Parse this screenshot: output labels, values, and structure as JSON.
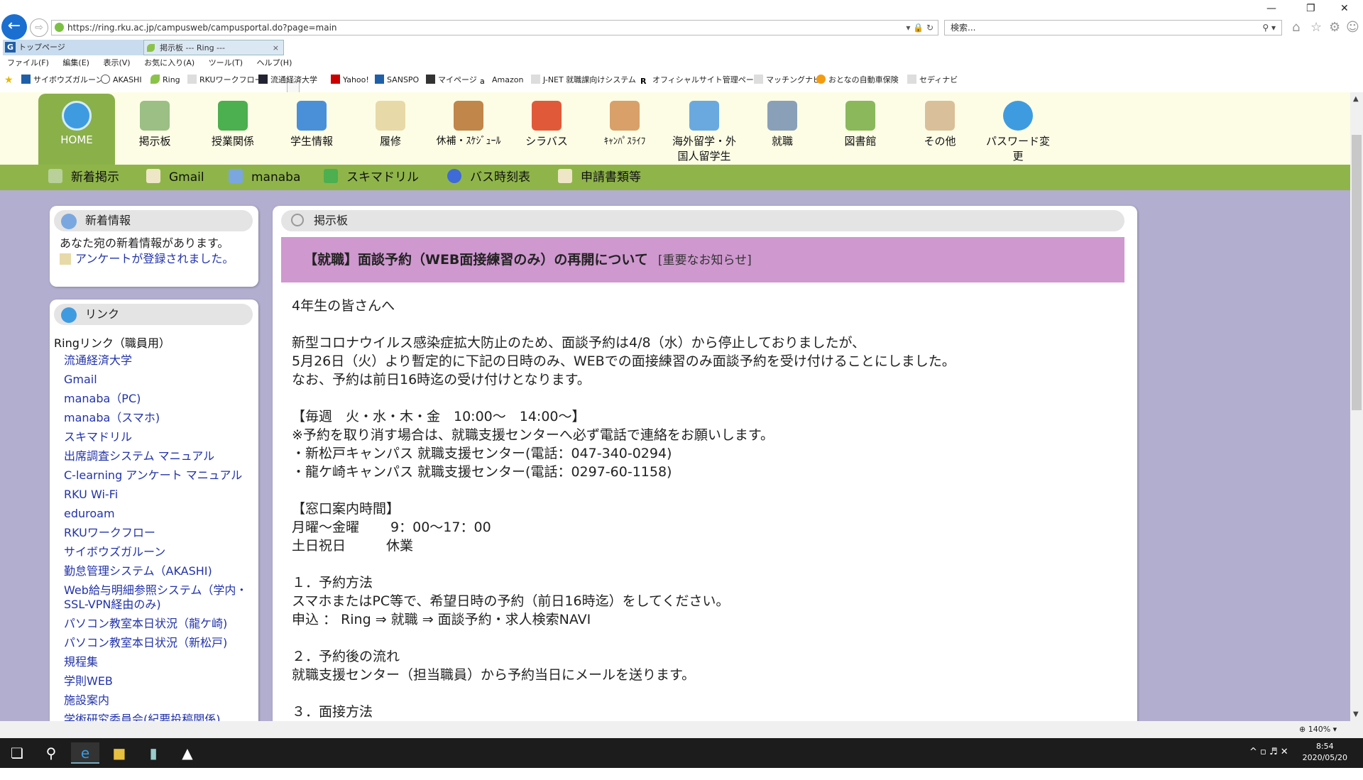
{
  "browser": {
    "url": "https://ring.rku.ac.jp/campusweb/campusportal.do?page=main",
    "search_placeholder": "検索...",
    "tabs": [
      {
        "label": "トップページ"
      },
      {
        "label": "掲示板 --- Ring ---"
      }
    ],
    "menu": [
      "ファイル(F)",
      "編集(E)",
      "表示(V)",
      "お気に入り(A)",
      "ツール(T)",
      "ヘルプ(H)"
    ],
    "favorites": [
      "サイボウズガルーン",
      "AKASHI",
      "Ring",
      "RKUワークフロー",
      "流通経済大学",
      "Yahoo!",
      "SANSPO",
      "マイページ",
      "Amazon",
      "J-NET 就職課向けシステム",
      "オフィシャルサイト管理ページ",
      "マッチングナビ",
      "おとなの自動車保険",
      "セディナビ"
    ],
    "zoom": "140%"
  },
  "topnav": [
    {
      "label": "HOME",
      "color": "#3f9be0"
    },
    {
      "label": "掲示板",
      "color": "#7fa36a"
    },
    {
      "label": "授業関係",
      "color": "#4caf50"
    },
    {
      "label": "学生情報",
      "color": "#4a90d9"
    },
    {
      "label": "履修",
      "color": "#e8d9a8"
    },
    {
      "label": "休補・ｽｹｼﾞｭｰﾙ",
      "color": "#c0864a"
    },
    {
      "label": "シラバス",
      "color": "#e05a3a"
    },
    {
      "label": "ｷｬﾝﾊﾟｽﾗｲﾌ",
      "color": "#d9a06a"
    },
    {
      "label": "海外留学・外国人留学生",
      "color": "#6aa9e0"
    },
    {
      "label": "就職",
      "color": "#8aa0b8"
    },
    {
      "label": "図書館",
      "color": "#8ab85a"
    },
    {
      "label": "その他",
      "color": "#d9c09a"
    },
    {
      "label": "パスワード変更",
      "color": "#3f9be0"
    }
  ],
  "subnav": [
    {
      "label": "新着掲示",
      "color": "#7fa36a"
    },
    {
      "label": "Gmail",
      "color": "#e8e0c0"
    },
    {
      "label": "manaba",
      "color": "#6a9ad9"
    },
    {
      "label": "スキマドリル",
      "color": "#4caf50"
    },
    {
      "label": "バス時刻表",
      "color": "#3f6ad9"
    },
    {
      "label": "申請書類等",
      "color": "#e8e0c0"
    }
  ],
  "news": {
    "title": "新着情報",
    "message": "あなた宛の新着情報があります。",
    "item": "アンケートが登録されました。"
  },
  "links": {
    "title": "リンク",
    "category": "Ringリンク（職員用）",
    "items": [
      "流通経済大学",
      "Gmail",
      "manaba（PC)",
      "manaba（スマホ)",
      "スキマドリル",
      "出席調査システム マニュアル",
      "C-learning アンケート マニュアル",
      "RKU Wi-Fi",
      "eduroam",
      "RKUワークフロー",
      "サイボウズガルーン",
      "勤怠管理システム（AKASHI)",
      "Web給与明細参照システム（学内・SSL-VPN経由のみ)",
      "パソコン教室本日状況（龍ケ崎)",
      "パソコン教室本日状況（新松戸)",
      "規程集",
      "学則WEB",
      "施設案内",
      "学術研究委員会(紀要投稿関係)"
    ]
  },
  "board": {
    "title": "掲示板",
    "notice_title": "【就職】面談予約（WEB面接練習のみ）の再開について",
    "notice_tag": "[重要なお知らせ]",
    "lines": [
      "4年生の皆さんへ",
      "",
      "新型コロナウイルス感染症拡大防止のため、面談予約は4/8（水）から停止しておりましたが、",
      "5月26日（火）より暫定的に下記の日時のみ、WEBでの面接練習のみ面談予約を受け付けることにしました。",
      "なお、予約は前日16時迄の受け付けとなります。",
      "",
      "【毎週　火・水・木・金　10:00～　14:00～】",
      "※予約を取り消す場合は、就職支援センターへ必ず電話で連絡をお願いします。",
      "・新松戸キャンパス 就職支援センター(電話：047-340-0294)",
      "・龍ケ崎キャンパス 就職支援センター(電話：0297-60-1158)",
      "",
      "【窓口案内時間】",
      "月曜～金曜　　 9：00～17：00",
      "土日祝日　　　休業",
      "",
      "１．予約方法",
      "スマホまたはPC等で、希望日時の予約（前日16時迄）をしてください。",
      "申込 ： Ring ⇒ 就職 ⇒ 面談予約・求人検索NAVI",
      "",
      "２．予約後の流れ",
      "就職支援センター（担当職員）から予約当日にメールを送ります。",
      "",
      "３．面接方法"
    ]
  },
  "taskbar": {
    "time": "8:54",
    "date": "2020/05/20"
  }
}
